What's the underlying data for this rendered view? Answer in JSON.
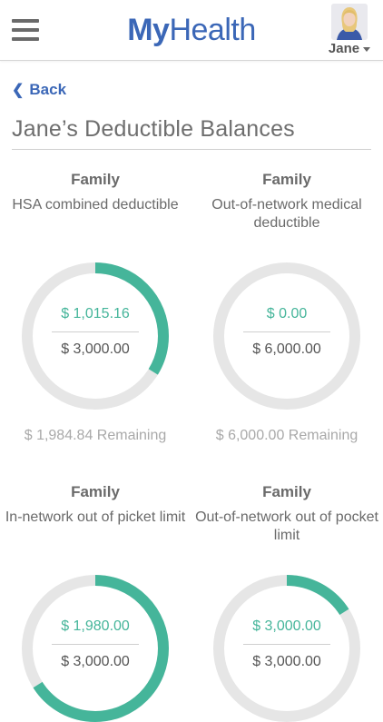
{
  "header": {
    "brand_my": "My",
    "brand_health": "Health",
    "user_name": "Jane",
    "menu_icon": "hamburger-menu-icon",
    "avatar_icon": "user-avatar-photo"
  },
  "nav": {
    "back_label": "Back"
  },
  "page": {
    "title": "Jane’s Deductible Balances"
  },
  "colors": {
    "brand": "#3b67b7",
    "accent": "#45b59a",
    "track": "#e6e6e6"
  },
  "cards": [
    {
      "label": "Family",
      "description": "HSA combined deductible",
      "used": "$ 1,015.16",
      "total": "$ 3,000.00",
      "remaining": "$ 1,984.84 Remaining",
      "fraction": 0.338
    },
    {
      "label": "Family",
      "description": "Out-of-network medical deductible",
      "used": "$ 0.00",
      "total": "$ 6,000.00",
      "remaining": "$ 6,000.00 Remaining",
      "fraction": 0
    },
    {
      "label": "Family",
      "description": "In-network out of picket limit",
      "used": "$ 1,980.00",
      "total": "$ 3,000.00",
      "remaining": "",
      "fraction": 0.66
    },
    {
      "label": "Family",
      "description": "Out-of-network out of pocket limit",
      "used": "$ 3,000.00",
      "total": "$ 3,000.00",
      "remaining": "",
      "fraction": 0.16
    }
  ]
}
